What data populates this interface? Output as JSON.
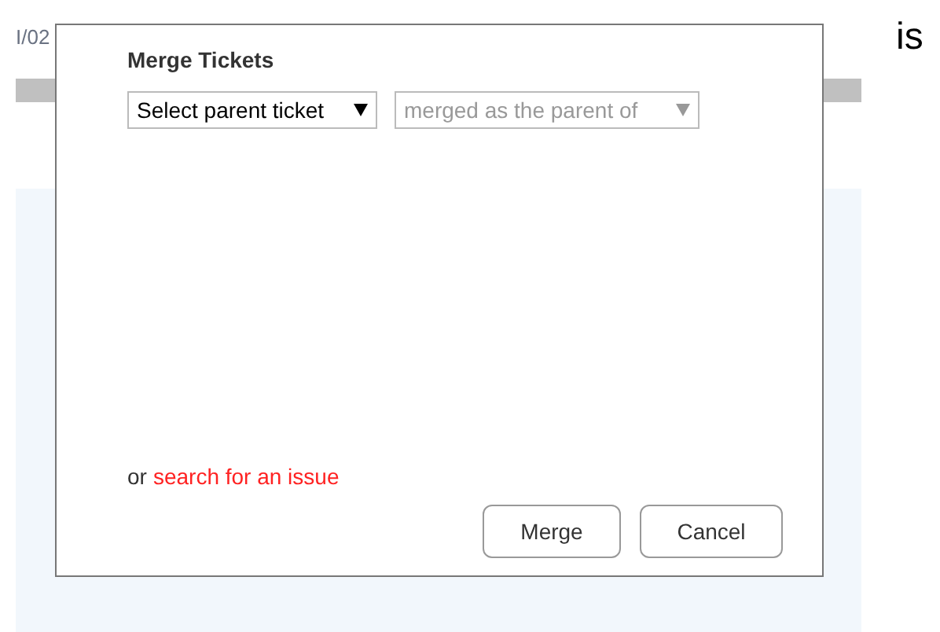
{
  "background": {
    "date_fragment": "I/02",
    "side_text": "is"
  },
  "dialog": {
    "title": "Merge Tickets",
    "selects": [
      {
        "value": "Select parent ticket",
        "disabled": false
      },
      {
        "value": "merged as the parent of",
        "disabled": true
      }
    ],
    "search_prefix": "or",
    "search_link": "search for an issue",
    "buttons": [
      "Merge",
      "Cancel"
    ]
  }
}
